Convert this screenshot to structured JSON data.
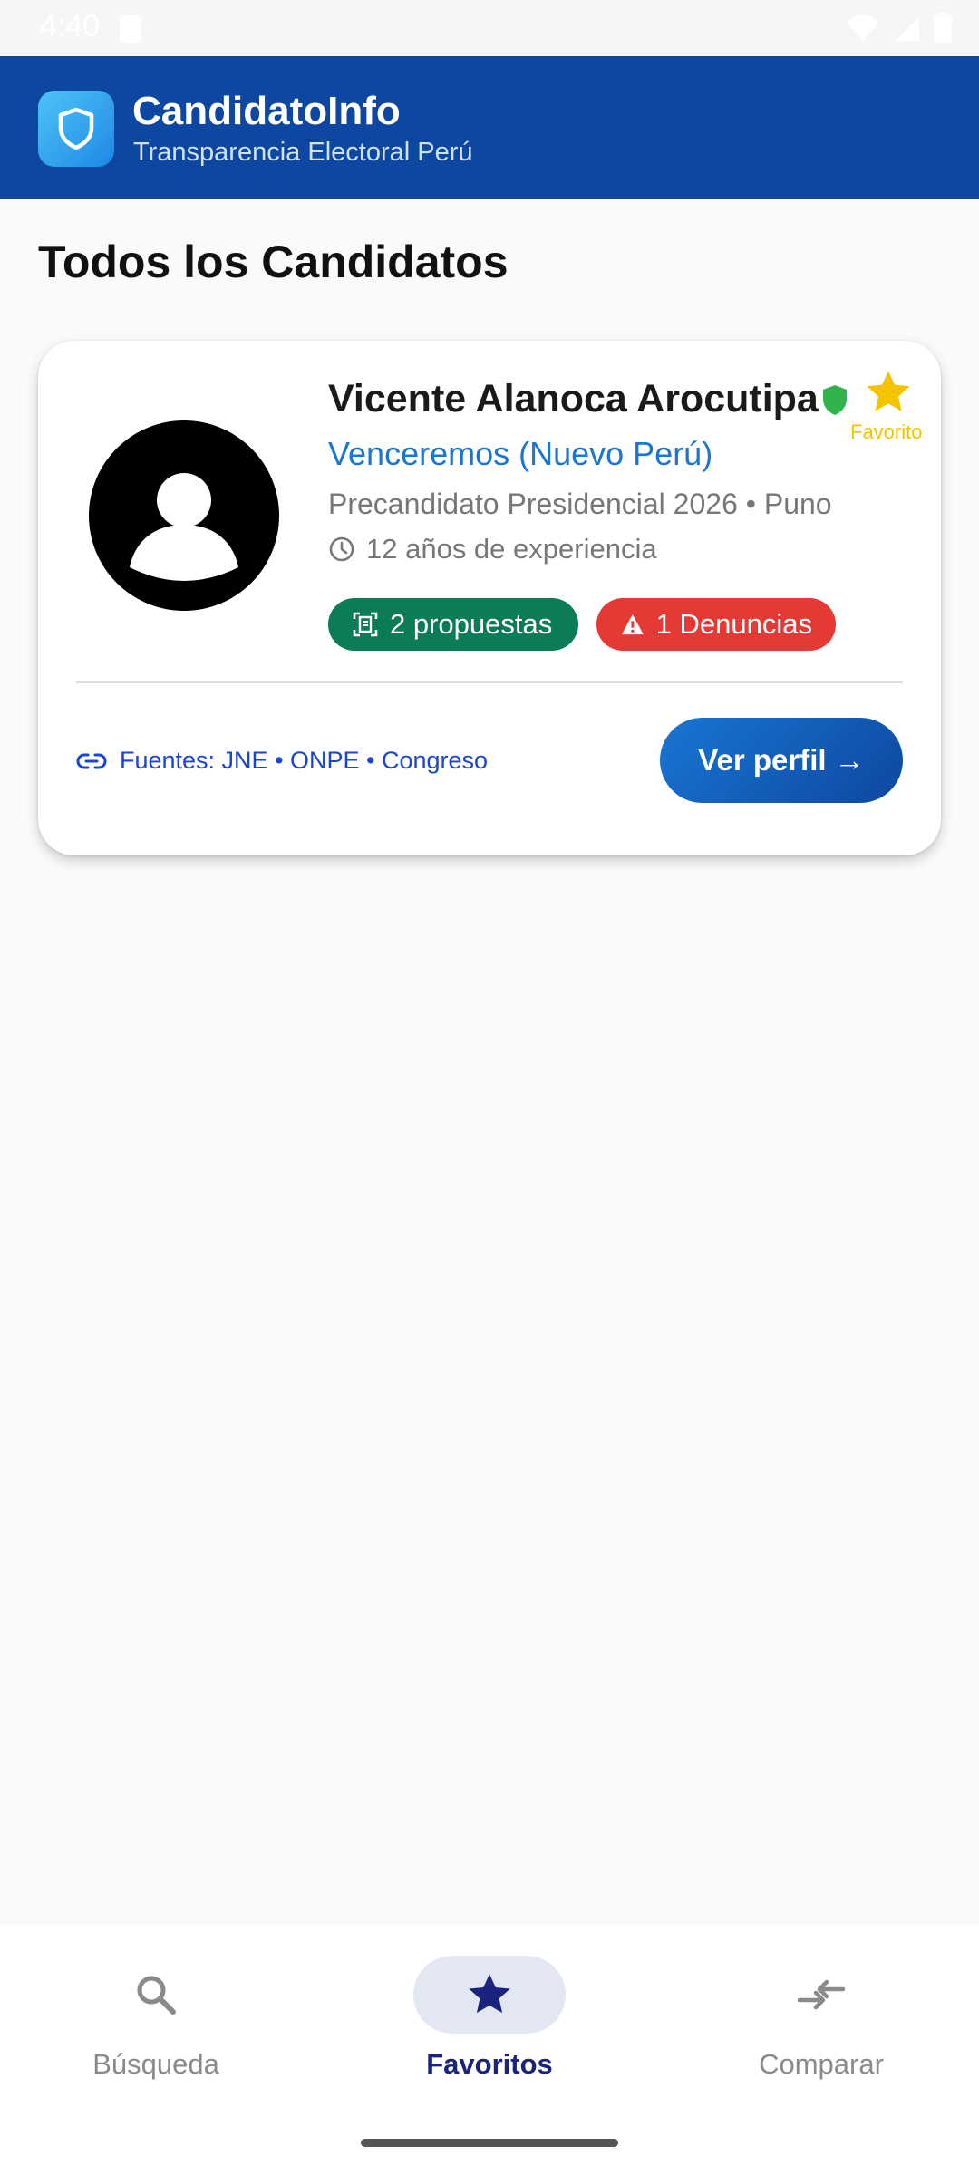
{
  "status_bar": {
    "time": "4:40"
  },
  "header": {
    "app_title": "CandidatoInfo",
    "app_subtitle": "Transparencia Electoral Perú",
    "logo_icon": "shield-icon"
  },
  "section": {
    "title": "Todos los Candidatos"
  },
  "candidate": {
    "name": "Vicente Alanoca Arocutipa",
    "party": "Venceremos (Nuevo Perú)",
    "position": "Precandidato Presidencial 2026 • Puno",
    "experience": "12 años de experiencia",
    "favorite_label": "Favorito",
    "proposals_chip": "2 propuestas",
    "complaints_chip": "1 Denuncias",
    "sources": "Fuentes: JNE • ONPE • Congreso",
    "view_button": "Ver perfil →"
  },
  "bottom_nav": {
    "items": [
      {
        "label": "Búsqueda",
        "icon": "search-icon",
        "active": false
      },
      {
        "label": "Favoritos",
        "icon": "star-icon",
        "active": true
      },
      {
        "label": "Comparar",
        "icon": "compare-arrows-icon",
        "active": false
      }
    ]
  },
  "colors": {
    "header_bg": "#0d47a1",
    "party": "#1976d2",
    "chip_green": "#0c7c57",
    "chip_red": "#e53935",
    "favorite": "#f5c400",
    "verified": "#2fb34a",
    "nav_active": "#1a237e"
  }
}
